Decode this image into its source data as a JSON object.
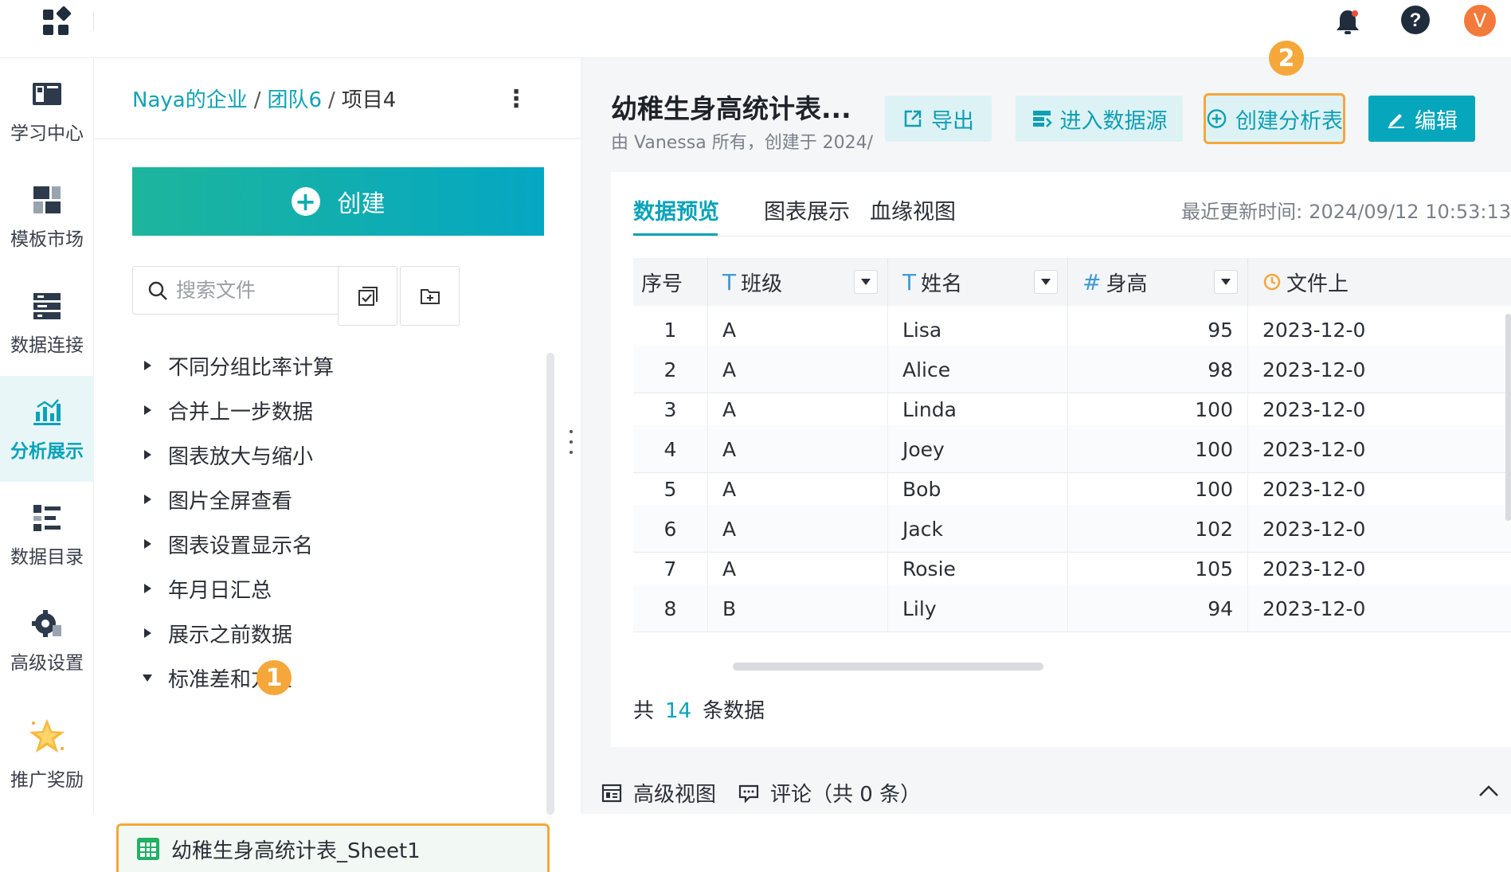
{
  "topbar": {
    "apps_icon": "apps-grid-icon",
    "bell_icon": "bell-icon",
    "help_icon": "help-icon",
    "avatar_letter": "V",
    "avatar_color": "#f27a3a"
  },
  "nav": {
    "items": [
      {
        "label": "学习中心",
        "icon": "book-icon"
      },
      {
        "label": "模板市场",
        "icon": "template-icon"
      },
      {
        "label": "数据连接",
        "icon": "database-connect-icon"
      },
      {
        "label": "分析展示",
        "icon": "analysis-chart-icon",
        "active": true
      },
      {
        "label": "数据目录",
        "icon": "catalog-icon"
      },
      {
        "label": "高级设置",
        "icon": "settings-gear-icon"
      },
      {
        "label": "推广奖励",
        "icon": "star-reward-icon"
      }
    ],
    "active_color": "#0aa3b8"
  },
  "filepanel": {
    "breadcrumb": {
      "company": "Naya的企业",
      "team": "团队6",
      "project": "项目4",
      "sep": "/"
    },
    "create_label": "创建",
    "search_placeholder": "搜索文件",
    "tree": [
      {
        "label": "不同分组比率计算",
        "expanded": false
      },
      {
        "label": "合并上一步数据",
        "expanded": false
      },
      {
        "label": "图表放大与缩小",
        "expanded": false
      },
      {
        "label": "图片全屏查看",
        "expanded": false
      },
      {
        "label": "图表设置显示名",
        "expanded": false
      },
      {
        "label": "年月日汇总",
        "expanded": false
      },
      {
        "label": "展示之前数据",
        "expanded": false
      },
      {
        "label": "标准差和方差",
        "expanded": true
      }
    ],
    "selected_sheet": "幼稚生身高统计表_Sheet1",
    "step_badge_1": "1"
  },
  "document": {
    "title": "幼稚生身高统计表...",
    "subtitle": "由 Vanessa 所有，创建于 2024/",
    "buttons": {
      "export": "导出",
      "datasource": "进入数据源",
      "create_analysis": "创建分析表",
      "edit": "编辑"
    },
    "step_badge_2": "2",
    "highlight_color": "#f5a73a"
  },
  "tabs": {
    "items": [
      "数据预览",
      "图表展示",
      "血缘视图"
    ],
    "active": 0,
    "update_label": "最近更新时间:",
    "update_time": "2024/09/12 10:53:13"
  },
  "table": {
    "columns": [
      {
        "label": "序号",
        "type": ""
      },
      {
        "label": "班级",
        "type": "T"
      },
      {
        "label": "姓名",
        "type": "T"
      },
      {
        "label": "身高",
        "type": "#"
      },
      {
        "label": "文件上",
        "type": "clock"
      }
    ],
    "rows": [
      {
        "idx": "1",
        "cls": "A",
        "name": "Lisa",
        "height": "95",
        "date": "2023-12-0"
      },
      {
        "idx": "2",
        "cls": "A",
        "name": "Alice",
        "height": "98",
        "date": "2023-12-0"
      },
      {
        "idx": "3",
        "cls": "A",
        "name": "Linda",
        "height": "100",
        "date": "2023-12-0"
      },
      {
        "idx": "4",
        "cls": "A",
        "name": "Joey",
        "height": "100",
        "date": "2023-12-0"
      },
      {
        "idx": "5",
        "cls": "A",
        "name": "Bob",
        "height": "100",
        "date": "2023-12-0"
      },
      {
        "idx": "6",
        "cls": "A",
        "name": "Jack",
        "height": "102",
        "date": "2023-12-0"
      },
      {
        "idx": "7",
        "cls": "A",
        "name": "Rosie",
        "height": "105",
        "date": "2023-12-0"
      },
      {
        "idx": "8",
        "cls": "B",
        "name": "Lily",
        "height": "94",
        "date": "2023-12-0"
      }
    ],
    "total_prefix": "共",
    "total_count": "14",
    "total_suffix": "条数据"
  },
  "bottom": {
    "advanced_view": "高级视图",
    "comments": "评论（共 0 条）"
  }
}
